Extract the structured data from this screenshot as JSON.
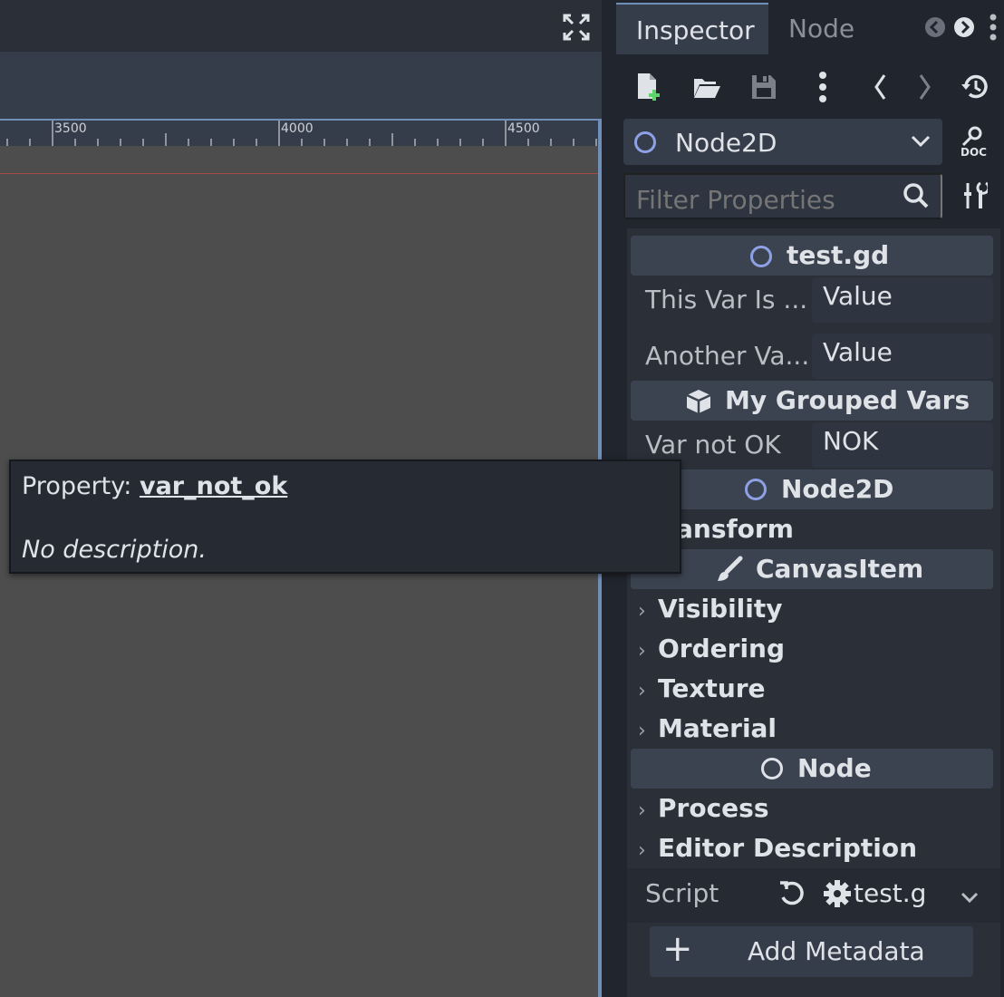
{
  "viewport": {
    "ruler_labels": [
      "3500",
      "4000",
      "4500"
    ]
  },
  "tooltip": {
    "prefix": "Property: ",
    "property_name": "var_not_ok",
    "description": "No description."
  },
  "inspector": {
    "tabs": [
      {
        "label": "Inspector",
        "active": true
      },
      {
        "label": "Node",
        "active": false
      }
    ],
    "toolbar_icons": [
      "new-resource-icon",
      "load-resource-icon",
      "save-resource-icon",
      "more-options-icon",
      "history-back-icon",
      "history-forward-icon",
      "object-history-icon"
    ],
    "selected_object": "Node2D",
    "doc_label": "DOC",
    "filter_placeholder": "Filter Properties",
    "sections": {
      "script": {
        "label": "test.gd"
      },
      "grouped": {
        "label": "My Grouped Vars"
      },
      "node2d": {
        "label": "Node2D"
      },
      "canvas": {
        "label": "CanvasItem"
      },
      "node": {
        "label": "Node"
      }
    },
    "properties": {
      "this_var": {
        "label": "This Var Is ...",
        "value": "Value"
      },
      "another_var": {
        "label": "Another Va...",
        "value": "Value"
      },
      "var_not_ok": {
        "label": "Var not OK",
        "value": "NOK"
      }
    },
    "groups": {
      "transform": "ansform",
      "visibility": "Visibility",
      "ordering": "Ordering",
      "texture": "Texture",
      "material": "Material",
      "process": "Process",
      "editor_description": "Editor Description"
    },
    "script_row": {
      "label": "Script",
      "value": "test.g"
    },
    "add_metadata": "Add Metadata",
    "colors": {
      "accent": "#6f8fb8",
      "node2d_icon": "#8ea1e6",
      "panel_bg": "#2a2f38",
      "section_header_bg": "#3c4350"
    }
  }
}
